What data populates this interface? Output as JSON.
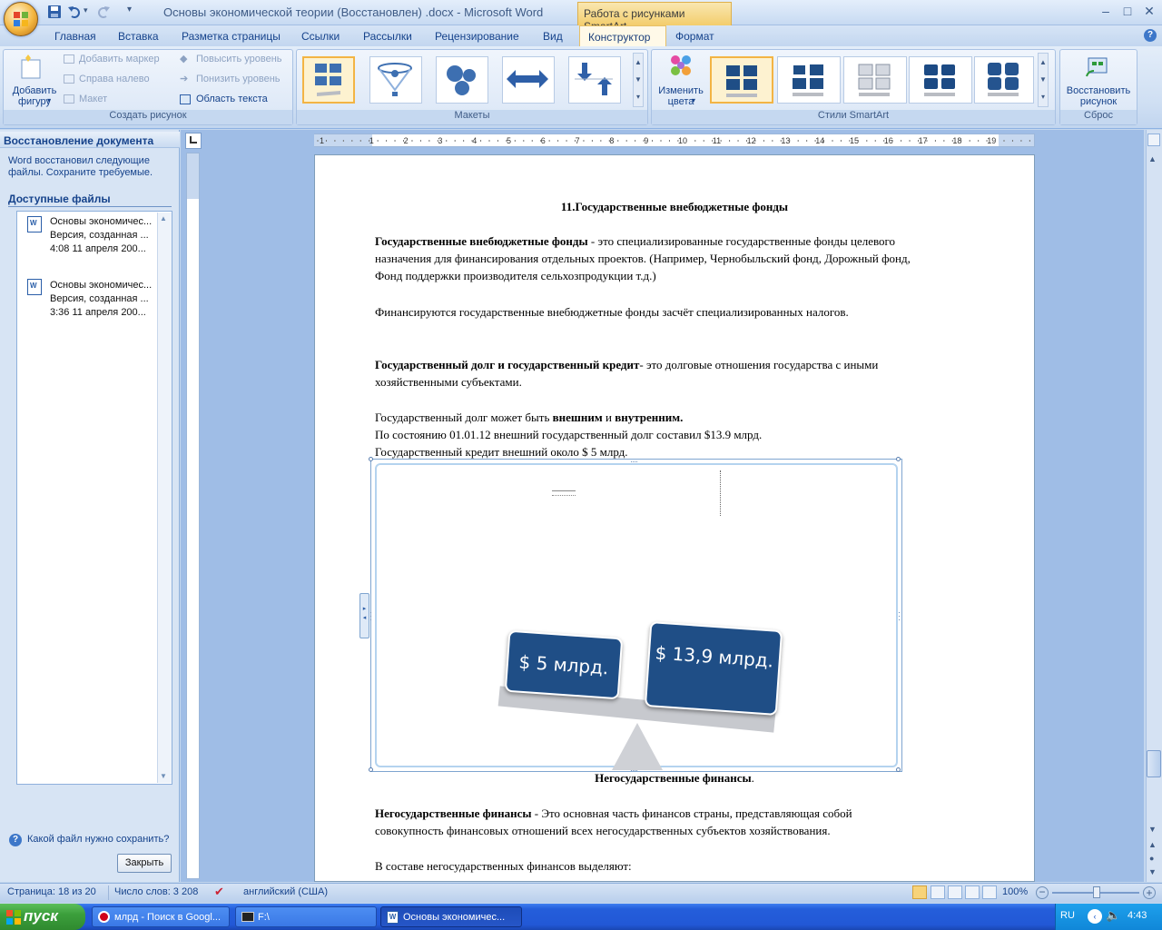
{
  "window": {
    "title": "Основы экономической теории (Восстановлен) .docx - Microsoft Word",
    "tools_tab": "Работа с рисунками SmartArt",
    "controls": {
      "minimize": "–",
      "maximize": "□",
      "close": "✕"
    }
  },
  "ribbon": {
    "tabs": [
      "Главная",
      "Вставка",
      "Разметка страницы",
      "Ссылки",
      "Рассылки",
      "Рецензирование",
      "Вид"
    ],
    "active_tab": "Конструктор",
    "format_tab": "Формат",
    "groups": {
      "create": {
        "label": "Создать рисунок",
        "add_shape": "Добавить фигуру",
        "add_marker": "Добавить маркер",
        "right_to_left": "Справа налево",
        "layout": "Макет",
        "promote": "Повысить уровень",
        "demote": "Понизить уровень",
        "text_pane": "Область текста"
      },
      "layouts": {
        "label": "Макеты"
      },
      "styles": {
        "label": "Стили SmartArt",
        "change_colors": "Изменить цвета"
      },
      "reset": {
        "label": "Сброс",
        "reset_graphic": "Восстановить рисунок"
      }
    }
  },
  "recovery_pane": {
    "title": "Восстановление документа",
    "message": "Word восстановил следующие файлы.  Сохраните требуемые.",
    "available_files": "Доступные файлы",
    "files": [
      {
        "name": "Основы экономичес...",
        "version": "Версия, созданная ...",
        "time": "4:08 11 апреля 200..."
      },
      {
        "name": "Основы экономичес...",
        "version": "Версия, созданная ...",
        "time": "3:36 11 апреля 200..."
      }
    ],
    "help_link": "Какой файл нужно сохранить?",
    "close_button": "Закрыть"
  },
  "document": {
    "heading": "11.Государственные внебюджетные фонды",
    "p1_bold": "Государственные внебюджетные фонды",
    "p1_rest_line1": " - это специализированные государственные фонды целевого",
    "p1_line2": "назначения для финансирования отдельных проектов. (Например, Чернобыльский фонд, Дорожный фонд,",
    "p1_line3": "Фонд поддержки производителя сельхозпродукции т.д.)",
    "p2": "Финансируются государственные внебюджетные фонды засчёт специализированных налогов.",
    "p3_bold": "Государственный долг и государственный кредит",
    "p3_rest_line1": "- это долговые отношения государства с иными",
    "p3_line2": "хозяйственными субъектами.",
    "p4_start": "Государственный долг может быть ",
    "p4_bold1": "внешним",
    "p4_mid": " и ",
    "p4_bold2": "внутренним.",
    "p5": "По состоянию 01.01.12 внешний государственный долг составил $13.9 млрд.",
    "p6": "Государственный кредит внешний около $ 5 млрд.",
    "smartart": {
      "left_weight": "$ 5 млрд.",
      "right_weight": "$ 13,9 млрд."
    },
    "heading2_bold": "Негосударственные финансы",
    "heading2_dot": ".",
    "p7_bold": "Негосударственные финансы",
    "p7_rest_line1": " - Это основная часть финансов страны, представляющая собой",
    "p7_line2": "совокупность финансовых отношений всех негосударственных субъектов хозяйствования.",
    "p8": "В составе негосударственных финансов выделяют:"
  },
  "statusbar": {
    "page": "Страница: 18 из 20",
    "words": "Число слов: 3 208",
    "language": "английский (США)",
    "zoom": "100%"
  },
  "taskbar": {
    "start": "пуск",
    "items": [
      "млрд - Поиск в Googl...",
      "F:\\",
      "Основы экономичес..."
    ],
    "lang": "RU",
    "time": "4:43"
  },
  "ruler_marks": [
    "1",
    "1",
    "2",
    "3",
    "4",
    "5",
    "6",
    "7",
    "8",
    "9",
    "10",
    "11",
    "12",
    "13",
    "14",
    "15",
    "16",
    "17",
    "18",
    "19"
  ],
  "colors": {
    "accent": "#1f4e86",
    "ribbon": "#dae6f6",
    "taskbar": "#245edb",
    "start": "#3c9f3c"
  }
}
